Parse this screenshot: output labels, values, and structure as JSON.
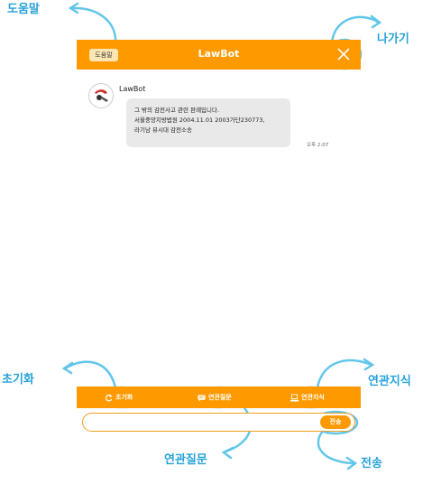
{
  "header": {
    "help_label": "도움말",
    "title": "LawBot"
  },
  "chat": {
    "bot_name": "LawBot",
    "message_lines": [
      "그 밖의 감전사고 관련 판례입니다.",
      "서울중앙지방법원 2004.11.01 2003가단230773,",
      "라기남 뷰시대 감전소송"
    ],
    "time": "오후 2:07"
  },
  "bottom": {
    "reset_label": "초기화",
    "related_questions_label": "연관질문",
    "related_knowledge_label": "연관지식",
    "send_label": "전송",
    "input_value": ""
  },
  "callouts": {
    "help": "도움말",
    "exit": "나가기",
    "reset": "초기화",
    "related_knowledge": "연관지식",
    "related_questions": "연관질문",
    "send": "전송"
  },
  "colors": {
    "accent": "#ff9900",
    "callout": "#27a3d9",
    "bubble": "#e9e9e9"
  }
}
